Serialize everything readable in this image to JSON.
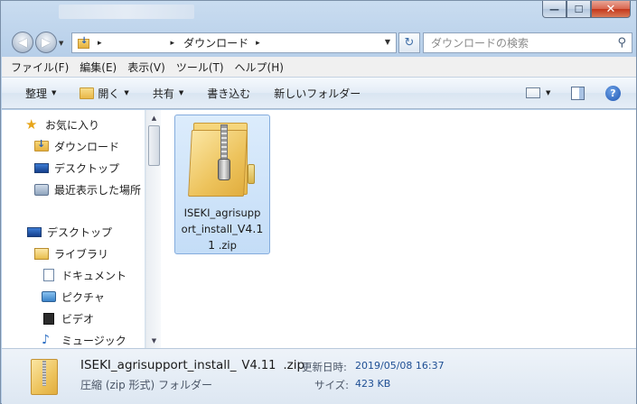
{
  "titlebar": {
    "minimize_glyph": "—",
    "maximize_glyph": "☐",
    "close_glyph": "✕"
  },
  "nav": {
    "back_glyph": "◀",
    "forward_glyph": "▶",
    "dropdown_glyph": "▼",
    "address_sep1": "▸",
    "address_sep2": "▸",
    "address_crumb": "ダウンロード",
    "address_sep3": "▸",
    "refresh_glyph": "↻",
    "search_placeholder": "ダウンロードの検索",
    "search_icon_glyph": "⚲"
  },
  "menu": {
    "file": "ファイル(F)",
    "edit": "編集(E)",
    "view": "表示(V)",
    "tools": "ツール(T)",
    "help": "ヘルプ(H)"
  },
  "toolbar": {
    "organize": "整理",
    "open": "開く",
    "share": "共有",
    "burn": "書き込む",
    "new_folder": "新しいフォルダー",
    "arrow": "▼",
    "help_glyph": "?"
  },
  "sidebar": {
    "items": [
      {
        "label": "お気に入り",
        "icon": "star-icon"
      },
      {
        "label": "ダウンロード",
        "icon": "downloads-folder-icon"
      },
      {
        "label": "デスクトップ",
        "icon": "desktop-icon"
      },
      {
        "label": "最近表示した場所",
        "icon": "recent-places-icon"
      },
      {
        "label": "デスクトップ",
        "icon": "desktop-icon"
      },
      {
        "label": "ライブラリ",
        "icon": "library-icon"
      },
      {
        "label": "ドキュメント",
        "icon": "documents-icon"
      },
      {
        "label": "ピクチャ",
        "icon": "pictures-icon"
      },
      {
        "label": "ビデオ",
        "icon": "videos-icon"
      },
      {
        "label": "ミュージック",
        "icon": "music-icon"
      }
    ],
    "scroll_up": "▲",
    "scroll_down": "▼"
  },
  "files": [
    {
      "line1": "ISEKI_agrisupp",
      "line2a": "ort_install_",
      "line2b": "V4.1",
      "line3a": "1",
      "line3b": " .zip",
      "selected": true,
      "icon": "zip-folder-icon"
    }
  ],
  "details": {
    "name_prefix": "ISEKI_agrisupport_install_",
    "name_version": "V4.11",
    "name_ext": ".zip",
    "type": "圧縮 (zip 形式) フォルダー",
    "modified_label": "更新日時:",
    "modified_value": "2019/05/08 16:37",
    "size_label": "サイズ:",
    "size_value": "423 KB"
  },
  "colors": {
    "selection": "#cce4fb",
    "accent_blue": "#1f4f94",
    "folder_yellow": "#edc35c"
  }
}
